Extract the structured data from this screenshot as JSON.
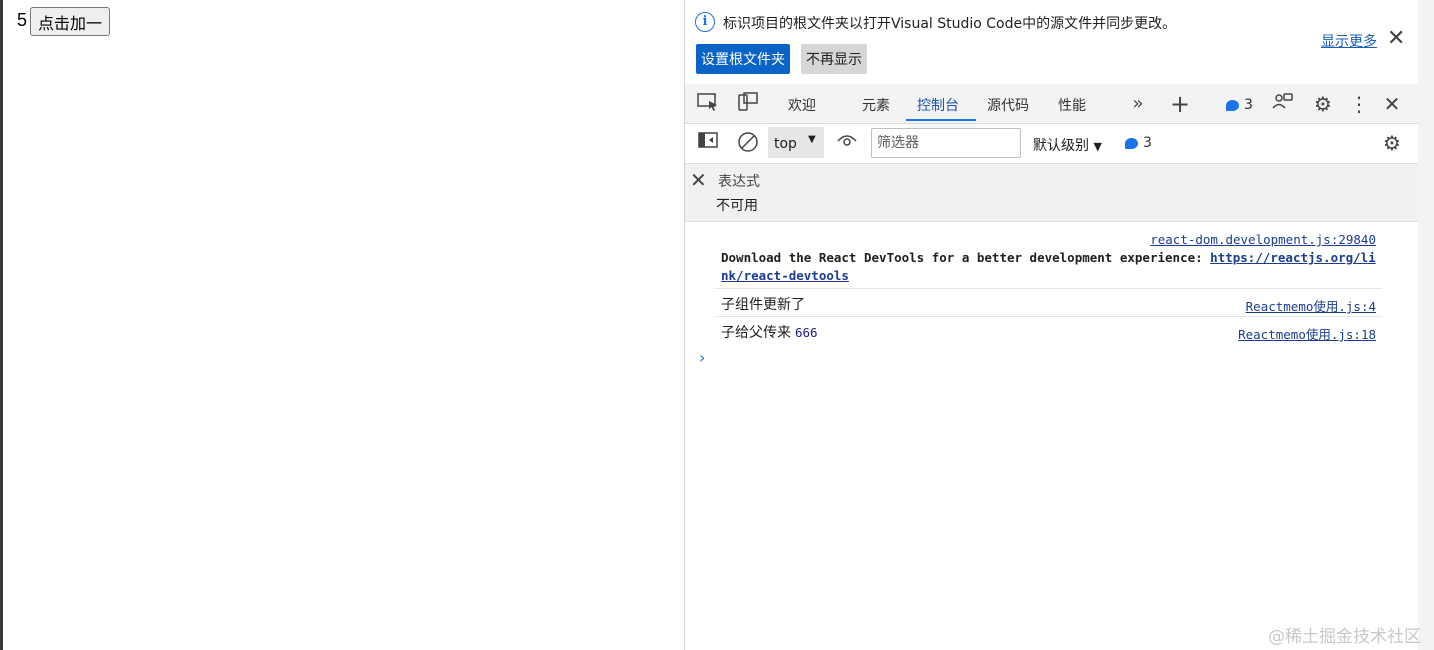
{
  "page": {
    "counter": "5",
    "button_label": "点击加一"
  },
  "infobar": {
    "message": "标识项目的根文件夹以打开Visual Studio Code中的源文件并同步更改。",
    "show_more": "显示更多",
    "set_root_button": "设置根文件夹",
    "dont_show_button": "不再显示",
    "accent": "#0a64c8"
  },
  "tabs": {
    "items": [
      {
        "label": "欢迎"
      },
      {
        "label": "元素"
      },
      {
        "label": "控制台",
        "active": true
      },
      {
        "label": "源代码"
      },
      {
        "label": "性能"
      }
    ],
    "issues_count": "3",
    "icons": [
      "inspect-icon",
      "device-toggle-icon",
      "more-tabs-icon",
      "add-tab-icon",
      "issues-icon",
      "connect-icon",
      "settings-icon",
      "kebab-icon",
      "close-icon"
    ]
  },
  "console_toolbar": {
    "context": "top",
    "filter_placeholder": "筛选器",
    "level": "默认级别",
    "issues_count": "3"
  },
  "expression": {
    "label": "表达式",
    "value": "不可用"
  },
  "messages": [
    {
      "source": "react-dom.development.js:29840",
      "text": "Download the React DevTools for a better development experience: ",
      "link": "https://reactjs.org/link/react-devtools"
    },
    {
      "source": "Reactmemo使用.js:4",
      "text": "子组件更新了"
    },
    {
      "source": "Reactmemo使用.js:18",
      "text": "子给父传来",
      "number": "666"
    }
  ],
  "watermark": "@稀土掘金技术社区"
}
